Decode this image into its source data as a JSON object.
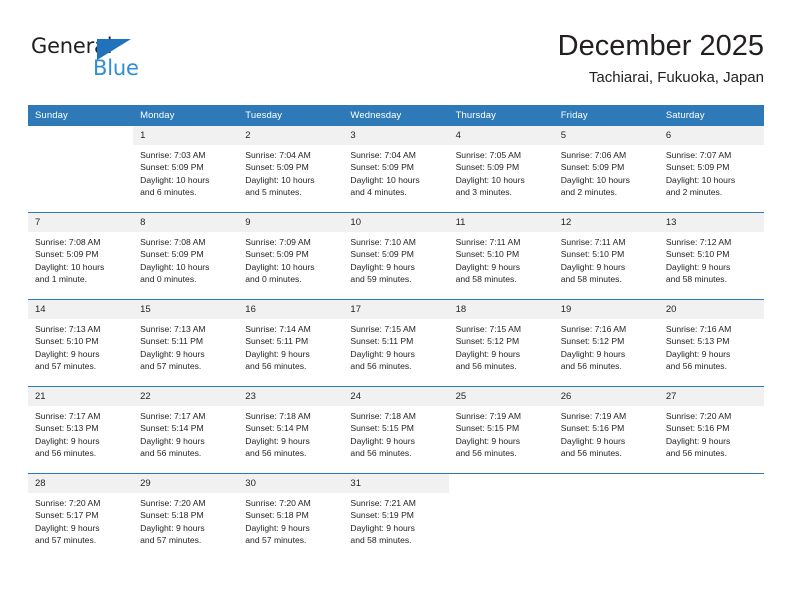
{
  "brand": {
    "name_top": "General",
    "name_bottom": "Blue",
    "color_dark": "#231f20",
    "color_blue": "#2f8fd4",
    "triangle_color": "#1f72bb"
  },
  "header": {
    "month_title": "December 2025",
    "location": "Tachiarai, Fukuoka, Japan"
  },
  "theme": {
    "header_blue": "#2e7ab8",
    "daynum_band": "#f1f1f1",
    "text": "#231f20"
  },
  "weekday_headers": [
    "Sunday",
    "Monday",
    "Tuesday",
    "Wednesday",
    "Thursday",
    "Friday",
    "Saturday"
  ],
  "weeks": [
    [
      {
        "day": "",
        "sunrise": "",
        "sunset": "",
        "daylight_1": "",
        "daylight_2": ""
      },
      {
        "day": "1",
        "sunrise": "Sunrise: 7:03 AM",
        "sunset": "Sunset: 5:09 PM",
        "daylight_1": "Daylight: 10 hours",
        "daylight_2": "and 6 minutes."
      },
      {
        "day": "2",
        "sunrise": "Sunrise: 7:04 AM",
        "sunset": "Sunset: 5:09 PM",
        "daylight_1": "Daylight: 10 hours",
        "daylight_2": "and 5 minutes."
      },
      {
        "day": "3",
        "sunrise": "Sunrise: 7:04 AM",
        "sunset": "Sunset: 5:09 PM",
        "daylight_1": "Daylight: 10 hours",
        "daylight_2": "and 4 minutes."
      },
      {
        "day": "4",
        "sunrise": "Sunrise: 7:05 AM",
        "sunset": "Sunset: 5:09 PM",
        "daylight_1": "Daylight: 10 hours",
        "daylight_2": "and 3 minutes."
      },
      {
        "day": "5",
        "sunrise": "Sunrise: 7:06 AM",
        "sunset": "Sunset: 5:09 PM",
        "daylight_1": "Daylight: 10 hours",
        "daylight_2": "and 2 minutes."
      },
      {
        "day": "6",
        "sunrise": "Sunrise: 7:07 AM",
        "sunset": "Sunset: 5:09 PM",
        "daylight_1": "Daylight: 10 hours",
        "daylight_2": "and 2 minutes."
      }
    ],
    [
      {
        "day": "7",
        "sunrise": "Sunrise: 7:08 AM",
        "sunset": "Sunset: 5:09 PM",
        "daylight_1": "Daylight: 10 hours",
        "daylight_2": "and 1 minute."
      },
      {
        "day": "8",
        "sunrise": "Sunrise: 7:08 AM",
        "sunset": "Sunset: 5:09 PM",
        "daylight_1": "Daylight: 10 hours",
        "daylight_2": "and 0 minutes."
      },
      {
        "day": "9",
        "sunrise": "Sunrise: 7:09 AM",
        "sunset": "Sunset: 5:09 PM",
        "daylight_1": "Daylight: 10 hours",
        "daylight_2": "and 0 minutes."
      },
      {
        "day": "10",
        "sunrise": "Sunrise: 7:10 AM",
        "sunset": "Sunset: 5:09 PM",
        "daylight_1": "Daylight: 9 hours",
        "daylight_2": "and 59 minutes."
      },
      {
        "day": "11",
        "sunrise": "Sunrise: 7:11 AM",
        "sunset": "Sunset: 5:10 PM",
        "daylight_1": "Daylight: 9 hours",
        "daylight_2": "and 58 minutes."
      },
      {
        "day": "12",
        "sunrise": "Sunrise: 7:11 AM",
        "sunset": "Sunset: 5:10 PM",
        "daylight_1": "Daylight: 9 hours",
        "daylight_2": "and 58 minutes."
      },
      {
        "day": "13",
        "sunrise": "Sunrise: 7:12 AM",
        "sunset": "Sunset: 5:10 PM",
        "daylight_1": "Daylight: 9 hours",
        "daylight_2": "and 58 minutes."
      }
    ],
    [
      {
        "day": "14",
        "sunrise": "Sunrise: 7:13 AM",
        "sunset": "Sunset: 5:10 PM",
        "daylight_1": "Daylight: 9 hours",
        "daylight_2": "and 57 minutes."
      },
      {
        "day": "15",
        "sunrise": "Sunrise: 7:13 AM",
        "sunset": "Sunset: 5:11 PM",
        "daylight_1": "Daylight: 9 hours",
        "daylight_2": "and 57 minutes."
      },
      {
        "day": "16",
        "sunrise": "Sunrise: 7:14 AM",
        "sunset": "Sunset: 5:11 PM",
        "daylight_1": "Daylight: 9 hours",
        "daylight_2": "and 56 minutes."
      },
      {
        "day": "17",
        "sunrise": "Sunrise: 7:15 AM",
        "sunset": "Sunset: 5:11 PM",
        "daylight_1": "Daylight: 9 hours",
        "daylight_2": "and 56 minutes."
      },
      {
        "day": "18",
        "sunrise": "Sunrise: 7:15 AM",
        "sunset": "Sunset: 5:12 PM",
        "daylight_1": "Daylight: 9 hours",
        "daylight_2": "and 56 minutes."
      },
      {
        "day": "19",
        "sunrise": "Sunrise: 7:16 AM",
        "sunset": "Sunset: 5:12 PM",
        "daylight_1": "Daylight: 9 hours",
        "daylight_2": "and 56 minutes."
      },
      {
        "day": "20",
        "sunrise": "Sunrise: 7:16 AM",
        "sunset": "Sunset: 5:13 PM",
        "daylight_1": "Daylight: 9 hours",
        "daylight_2": "and 56 minutes."
      }
    ],
    [
      {
        "day": "21",
        "sunrise": "Sunrise: 7:17 AM",
        "sunset": "Sunset: 5:13 PM",
        "daylight_1": "Daylight: 9 hours",
        "daylight_2": "and 56 minutes."
      },
      {
        "day": "22",
        "sunrise": "Sunrise: 7:17 AM",
        "sunset": "Sunset: 5:14 PM",
        "daylight_1": "Daylight: 9 hours",
        "daylight_2": "and 56 minutes."
      },
      {
        "day": "23",
        "sunrise": "Sunrise: 7:18 AM",
        "sunset": "Sunset: 5:14 PM",
        "daylight_1": "Daylight: 9 hours",
        "daylight_2": "and 56 minutes."
      },
      {
        "day": "24",
        "sunrise": "Sunrise: 7:18 AM",
        "sunset": "Sunset: 5:15 PM",
        "daylight_1": "Daylight: 9 hours",
        "daylight_2": "and 56 minutes."
      },
      {
        "day": "25",
        "sunrise": "Sunrise: 7:19 AM",
        "sunset": "Sunset: 5:15 PM",
        "daylight_1": "Daylight: 9 hours",
        "daylight_2": "and 56 minutes."
      },
      {
        "day": "26",
        "sunrise": "Sunrise: 7:19 AM",
        "sunset": "Sunset: 5:16 PM",
        "daylight_1": "Daylight: 9 hours",
        "daylight_2": "and 56 minutes."
      },
      {
        "day": "27",
        "sunrise": "Sunrise: 7:20 AM",
        "sunset": "Sunset: 5:16 PM",
        "daylight_1": "Daylight: 9 hours",
        "daylight_2": "and 56 minutes."
      }
    ],
    [
      {
        "day": "28",
        "sunrise": "Sunrise: 7:20 AM",
        "sunset": "Sunset: 5:17 PM",
        "daylight_1": "Daylight: 9 hours",
        "daylight_2": "and 57 minutes."
      },
      {
        "day": "29",
        "sunrise": "Sunrise: 7:20 AM",
        "sunset": "Sunset: 5:18 PM",
        "daylight_1": "Daylight: 9 hours",
        "daylight_2": "and 57 minutes."
      },
      {
        "day": "30",
        "sunrise": "Sunrise: 7:20 AM",
        "sunset": "Sunset: 5:18 PM",
        "daylight_1": "Daylight: 9 hours",
        "daylight_2": "and 57 minutes."
      },
      {
        "day": "31",
        "sunrise": "Sunrise: 7:21 AM",
        "sunset": "Sunset: 5:19 PM",
        "daylight_1": "Daylight: 9 hours",
        "daylight_2": "and 58 minutes."
      },
      {
        "day": "",
        "sunrise": "",
        "sunset": "",
        "daylight_1": "",
        "daylight_2": ""
      },
      {
        "day": "",
        "sunrise": "",
        "sunset": "",
        "daylight_1": "",
        "daylight_2": ""
      },
      {
        "day": "",
        "sunrise": "",
        "sunset": "",
        "daylight_1": "",
        "daylight_2": ""
      }
    ]
  ]
}
